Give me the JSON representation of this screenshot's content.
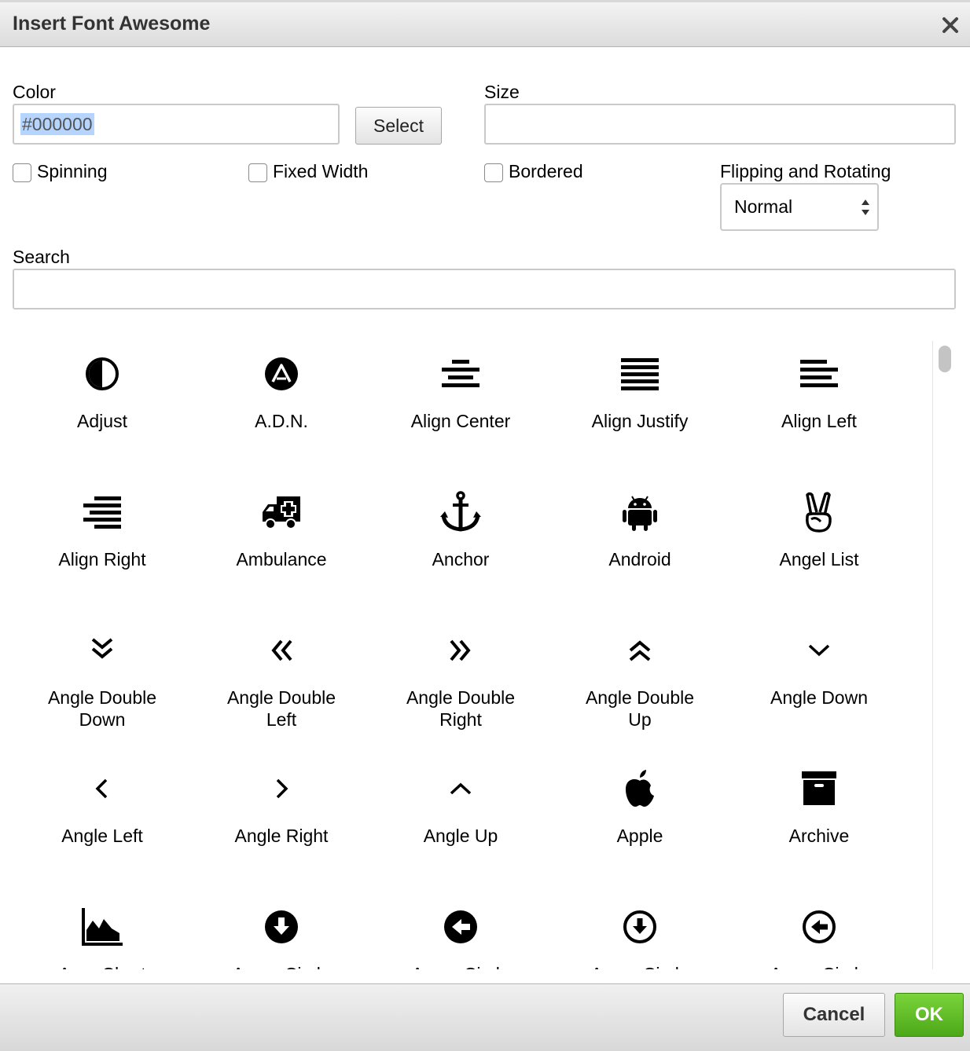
{
  "dialog": {
    "title": "Insert Font Awesome"
  },
  "color": {
    "label": "Color",
    "value": "#000000",
    "select_label": "Select"
  },
  "size": {
    "label": "Size",
    "value": ""
  },
  "options": {
    "spinning": "Spinning",
    "fixed_width": "Fixed Width",
    "bordered": "Bordered"
  },
  "flip": {
    "label": "Flipping and Rotating",
    "selected": "Normal"
  },
  "search": {
    "label": "Search",
    "value": ""
  },
  "icons": [
    {
      "name": "Adjust",
      "icon": "adjust-icon"
    },
    {
      "name": "A.D.N.",
      "icon": "adn-icon"
    },
    {
      "name": "Align Center",
      "icon": "align-center-icon"
    },
    {
      "name": "Align Justify",
      "icon": "align-justify-icon"
    },
    {
      "name": "Align Left",
      "icon": "align-left-icon"
    },
    {
      "name": "Align Right",
      "icon": "align-right-icon"
    },
    {
      "name": "Ambulance",
      "icon": "ambulance-icon"
    },
    {
      "name": "Anchor",
      "icon": "anchor-icon"
    },
    {
      "name": "Android",
      "icon": "android-icon"
    },
    {
      "name": "Angel List",
      "icon": "angellist-icon"
    },
    {
      "name": "Angle Double Down",
      "icon": "angle-double-down-icon"
    },
    {
      "name": "Angle Double Left",
      "icon": "angle-double-left-icon"
    },
    {
      "name": "Angle Double Right",
      "icon": "angle-double-right-icon"
    },
    {
      "name": "Angle Double Up",
      "icon": "angle-double-up-icon"
    },
    {
      "name": "Angle Down",
      "icon": "angle-down-icon"
    },
    {
      "name": "Angle Left",
      "icon": "angle-left-icon"
    },
    {
      "name": "Angle Right",
      "icon": "angle-right-icon"
    },
    {
      "name": "Angle Up",
      "icon": "angle-up-icon"
    },
    {
      "name": "Apple",
      "icon": "apple-icon"
    },
    {
      "name": "Archive",
      "icon": "archive-icon"
    },
    {
      "name": "Area Chart",
      "icon": "area-chart-icon"
    },
    {
      "name": "Arrow Circle",
      "icon": "arrow-circle-down-icon"
    },
    {
      "name": "Arrow Circle",
      "icon": "arrow-circle-left-icon"
    },
    {
      "name": "Arrow Circle",
      "icon": "arrow-circle-o-down-icon"
    },
    {
      "name": "Arrow Circle",
      "icon": "arrow-circle-o-left-icon"
    }
  ],
  "footer": {
    "cancel_label": "Cancel",
    "ok_label": "OK"
  },
  "colors": {
    "ok_green": "#5cb82a",
    "selection": "#b5d5ff"
  }
}
